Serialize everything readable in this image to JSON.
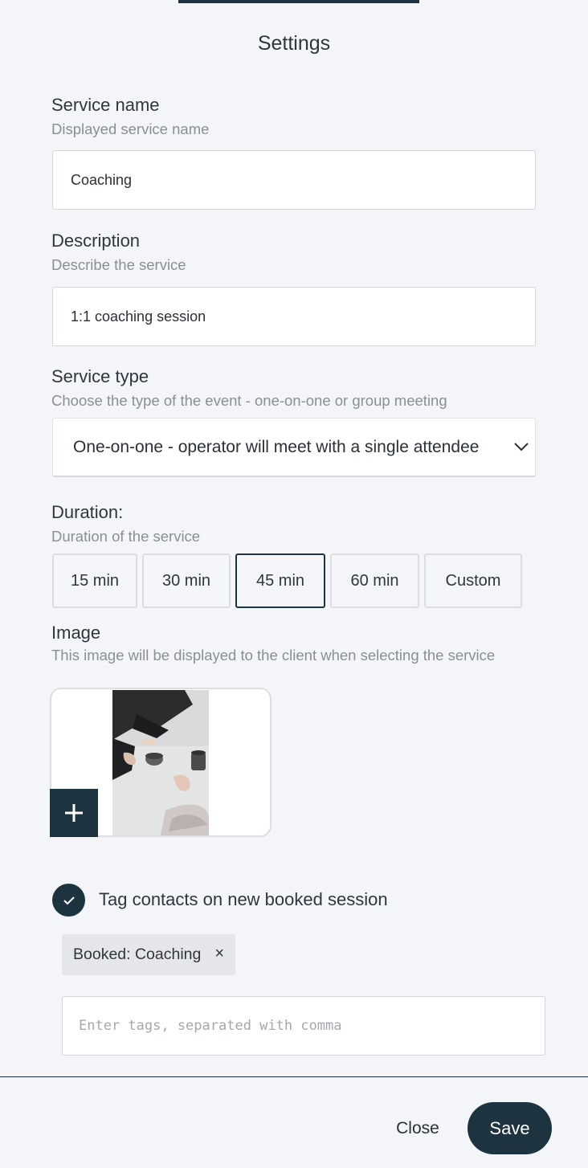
{
  "page": {
    "title": "Settings"
  },
  "service_name": {
    "label": "Service name",
    "hint": "Displayed service name",
    "value": "Coaching"
  },
  "description": {
    "label": "Description",
    "hint": "Describe the service",
    "value": "1:1 coaching session"
  },
  "service_type": {
    "label": "Service type",
    "hint": "Choose the type of the event - one-on-one or group meeting",
    "selected": "One-on-one - operator will meet with a single attendee",
    "icon": "chevron-down-icon"
  },
  "duration": {
    "label": "Duration:",
    "hint": "Duration of the service",
    "options": [
      "15 min",
      "30 min",
      "45 min",
      "60 min",
      "Custom"
    ],
    "selected": "45 min"
  },
  "image": {
    "label": "Image",
    "hint": "This image will be displayed to the client when selecting the service",
    "add_icon": "plus-icon"
  },
  "tagging": {
    "checkbox_label": "Tag contacts on new booked session",
    "checked": true,
    "tags": [
      {
        "label": "Booked: Coaching",
        "remove": "×"
      }
    ],
    "input_placeholder": "Enter tags, separated with comma"
  },
  "footer": {
    "close_label": "Close",
    "save_label": "Save"
  },
  "colors": {
    "primary": "#1d3440",
    "background": "#f3f5f8",
    "border": "#d2d5d9"
  }
}
